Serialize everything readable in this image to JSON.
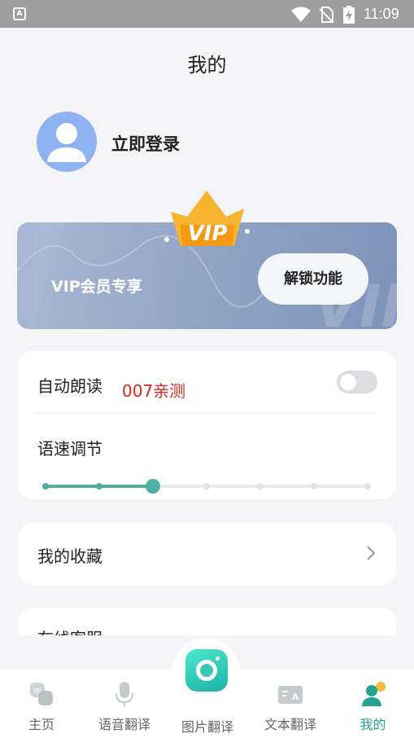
{
  "status_bar": {
    "time": "11:09",
    "app_glyph": "A"
  },
  "header": {
    "title": "我的"
  },
  "profile": {
    "login_label": "立即登录",
    "avatar_color": "#8fb3f2"
  },
  "vip": {
    "crown_text": "VIP",
    "title": "VIP会员专享",
    "unlock_label": "解锁功能"
  },
  "settings": {
    "auto_read_label": "自动朗读",
    "test_tag": "007亲测",
    "auto_read_enabled": false,
    "speed_label": "语速调节",
    "speed_level": 3,
    "speed_steps": 7
  },
  "favorites": {
    "label": "我的收藏"
  },
  "next_row": {
    "label": "在线客服"
  },
  "bottom_nav": {
    "items": [
      {
        "label": "主页",
        "icon": "home-translate-icon",
        "active": false
      },
      {
        "label": "语音翻译",
        "icon": "microphone-icon",
        "active": false
      },
      {
        "label": "图片翻译",
        "icon": "camera-icon",
        "active": false
      },
      {
        "label": "文本翻译",
        "icon": "text-translate-icon",
        "active": false
      },
      {
        "label": "我的",
        "icon": "profile-icon",
        "active": true
      }
    ]
  },
  "colors": {
    "accent": "#4fb0a1",
    "active_tab": "#23a58d",
    "test_tag": "#d8271c",
    "vip_gold": "#f6a21d"
  }
}
